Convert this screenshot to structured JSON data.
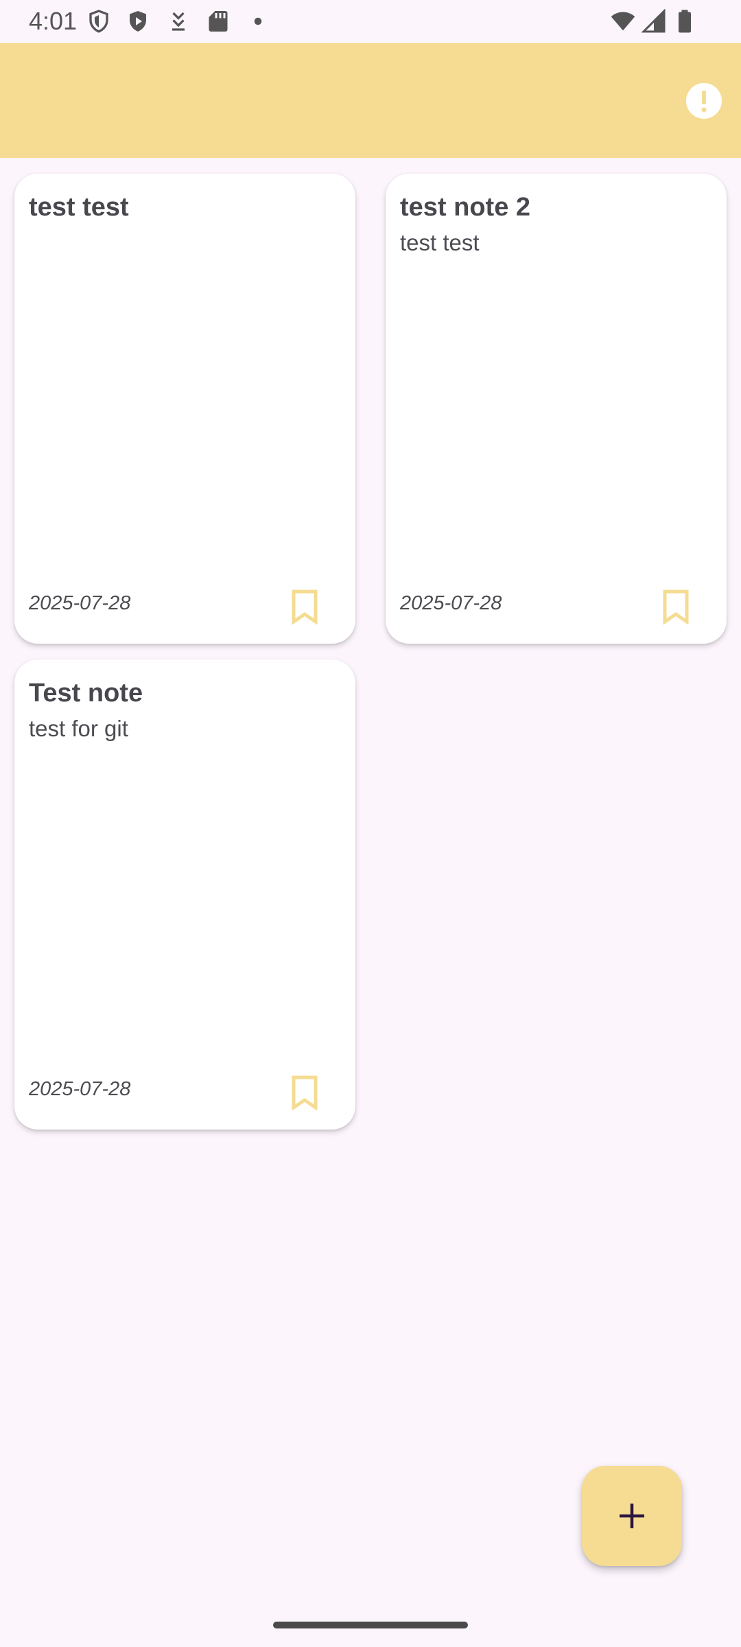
{
  "status_bar": {
    "time": "4:01",
    "left_icons": [
      "shield-outline-icon",
      "shield-play-icon",
      "download-arrow-icon",
      "sd-card-icon",
      "notification-dot-icon"
    ],
    "right_icons": [
      "wifi-icon",
      "cell-signal-icon",
      "battery-icon"
    ]
  },
  "app_bar": {
    "action_icon": "info-icon"
  },
  "notes": [
    {
      "title": "test test",
      "body": "",
      "date": "2025-07-28",
      "bookmark_icon": "bookmark-outline-icon"
    },
    {
      "title": "test note 2",
      "body": "test test",
      "date": "2025-07-28",
      "bookmark_icon": "bookmark-outline-icon"
    },
    {
      "title": "Test note",
      "body": "test for git",
      "date": "2025-07-28",
      "bookmark_icon": "bookmark-outline-icon"
    }
  ],
  "fab": {
    "icon": "plus-icon"
  },
  "colors": {
    "accent": "#F5DC92",
    "background": "#FCF5FC",
    "card": "#FFFFFF",
    "text": "#48474D",
    "fab_icon": "#2A1540"
  }
}
